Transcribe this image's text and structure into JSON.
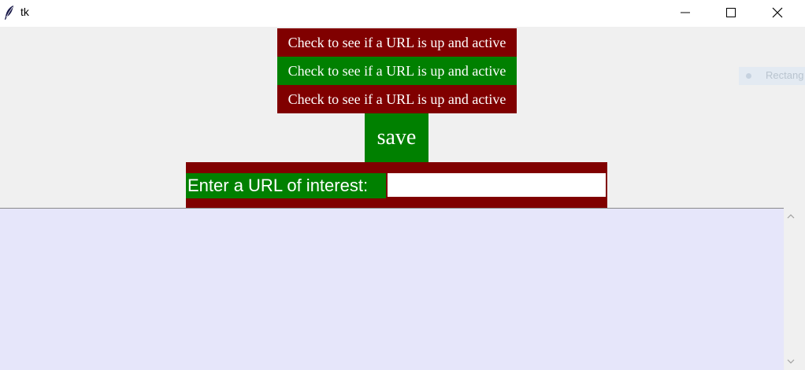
{
  "window": {
    "title": "tk"
  },
  "buttons": {
    "check_1": "Check to see if a URL is up and active",
    "check_2": "Check to see if a URL is up and active",
    "check_3": "Check to see if a URL is up and active",
    "save": "save"
  },
  "url_form": {
    "label": "Enter a URL of interest:",
    "value": ""
  },
  "overlay": {
    "text": "Rectang"
  },
  "colors": {
    "maroon": "#800000",
    "green": "#008000",
    "text_area_bg": "#e6e6fa",
    "window_bg": "#f0f0f0"
  }
}
